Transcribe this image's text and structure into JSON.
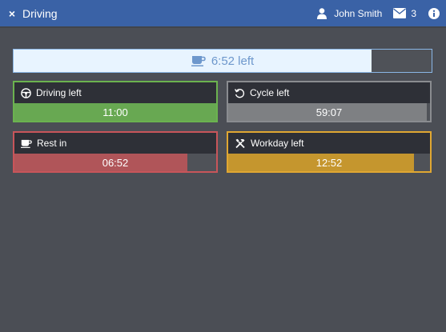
{
  "header": {
    "close_symbol": "×",
    "title": "Driving",
    "user_name": "John Smith",
    "message_count": "3",
    "icons": [
      "close-icon",
      "user-icon",
      "envelope-icon",
      "info-icon"
    ]
  },
  "break_status": {
    "label": "6:52 left",
    "icon": "coffee-cup-icon",
    "progress": 0.857,
    "colors": {
      "fill": "#e8f4ff",
      "border": "#8ab6e6",
      "text": "#6d97cc"
    }
  },
  "cards": [
    {
      "label": "Driving left",
      "value": "11:00",
      "icon": "steering-wheel-icon",
      "progress": 1.0,
      "color": "#68a852",
      "border": "#6bb34f"
    },
    {
      "label": "Cycle left",
      "value": "59:07",
      "icon": "cycle-icon",
      "progress": 0.985,
      "color": "#7e8083",
      "border": "#8a8c90"
    },
    {
      "label": "Rest in",
      "value": "06:52",
      "icon": "coffee-cup-icon",
      "progress": 0.857,
      "color": "#b05559",
      "border": "#c8555a"
    },
    {
      "label": "Workday left",
      "value": "12:52",
      "icon": "tools-icon",
      "progress": 0.919,
      "color": "#c5962e",
      "border": "#e0a732"
    }
  ]
}
